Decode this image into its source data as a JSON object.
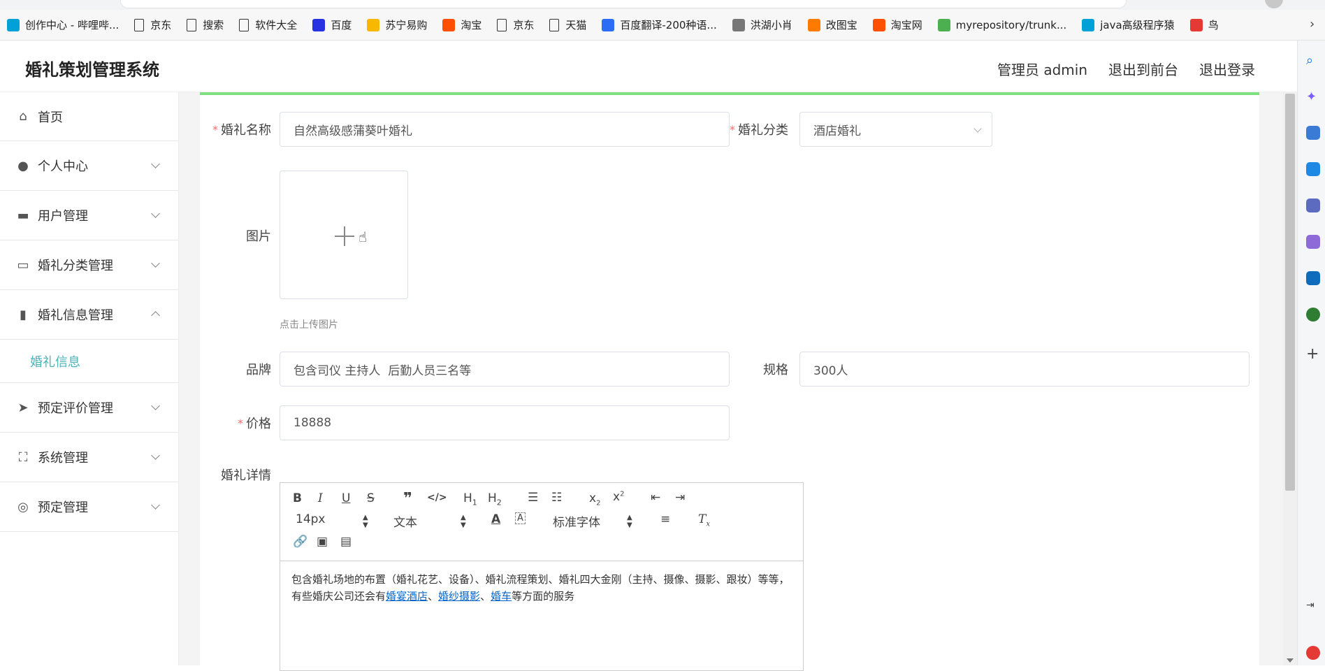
{
  "bookmarks": [
    {
      "label": "创作中心 - 哔哩哔...",
      "icon": "bilibili-icon",
      "color": "#00a1d6"
    },
    {
      "label": "京东",
      "icon": "document-icon"
    },
    {
      "label": "搜索",
      "icon": "document-icon"
    },
    {
      "label": "软件大全",
      "icon": "document-icon"
    },
    {
      "label": "百度",
      "icon": "baidu-paw-icon",
      "color": "#2932e1"
    },
    {
      "label": "苏宁易购",
      "icon": "suning-icon",
      "color": "#f9b800"
    },
    {
      "label": "淘宝",
      "icon": "taobao-icon",
      "color": "#ff5000"
    },
    {
      "label": "京东",
      "icon": "document-icon"
    },
    {
      "label": "天猫",
      "icon": "document-icon"
    },
    {
      "label": "百度翻译-200种语...",
      "icon": "baidu-translate-icon",
      "color": "#2b6ef5"
    },
    {
      "label": "洪湖小肖",
      "icon": "eagle-icon",
      "color": "#777777"
    },
    {
      "label": "改图宝",
      "icon": "gaitubao-icon",
      "color": "#ff7a00"
    },
    {
      "label": "淘宝网",
      "icon": "taobao-icon",
      "color": "#ff5000"
    },
    {
      "label": "myrepository/trunk...",
      "icon": "repo-icon",
      "color": "#4caf50"
    },
    {
      "label": "java高级程序猿",
      "icon": "bilibili-icon",
      "color": "#00a1d6"
    },
    {
      "label": "鸟",
      "icon": "bird-icon",
      "color": "#e53935"
    }
  ],
  "header": {
    "title": "婚礼策划管理系统",
    "admin": "管理员 admin",
    "front": "退出到前台",
    "logout": "退出登录"
  },
  "sidebar": {
    "items": [
      {
        "label": "首页",
        "icon": "home-icon",
        "chevron": "none"
      },
      {
        "label": "个人中心",
        "icon": "user-icon",
        "chevron": "down"
      },
      {
        "label": "用户管理",
        "icon": "chat-icon",
        "chevron": "down"
      },
      {
        "label": "婚礼分类管理",
        "icon": "box-icon",
        "chevron": "down"
      },
      {
        "label": "婚礼信息管理",
        "icon": "bar-chart-icon",
        "chevron": "up"
      },
      {
        "label": "预定评价管理",
        "icon": "send-icon",
        "chevron": "down"
      },
      {
        "label": "系统管理",
        "icon": "fullscreen-icon",
        "chevron": "down"
      },
      {
        "label": "预定管理",
        "icon": "lifebuoy-icon",
        "chevron": "down"
      }
    ],
    "submenu": "婚礼信息"
  },
  "form": {
    "name_label": "婚礼名称",
    "name_value": "自然高级感蒲葵叶婚礼",
    "category_label": "婚礼分类",
    "category_value": "酒店婚礼",
    "image_label": "图片",
    "upload_hint": "点击上传图片",
    "brand_label": "品牌",
    "brand_value": "包含司仪 主持人  后勤人员三名等",
    "spec_label": "规格",
    "spec_value": "300人",
    "price_label": "价格",
    "price_value": "18888",
    "detail_label": "婚礼详情",
    "required_mark": "*"
  },
  "editor": {
    "font_size": "14px",
    "block_type": "文本",
    "font_family": "标准字体",
    "content_text": "包含婚礼场地的布置（婚礼花艺、设备）、婚礼流程策划、婚礼四大金刚（主持、摄像、摄影、跟妆）等等，有些婚庆公司还会有",
    "link1": "婚宴酒店",
    "sep1": "、",
    "link2": "婚纱摄影",
    "sep2": "、",
    "link3": "婚车",
    "content_tail": "等方面的服务"
  },
  "colors": {
    "accent": "#4eb3b7",
    "top_bar": "#7fe07f",
    "required": "#f56c6c",
    "link": "#0066cc"
  }
}
